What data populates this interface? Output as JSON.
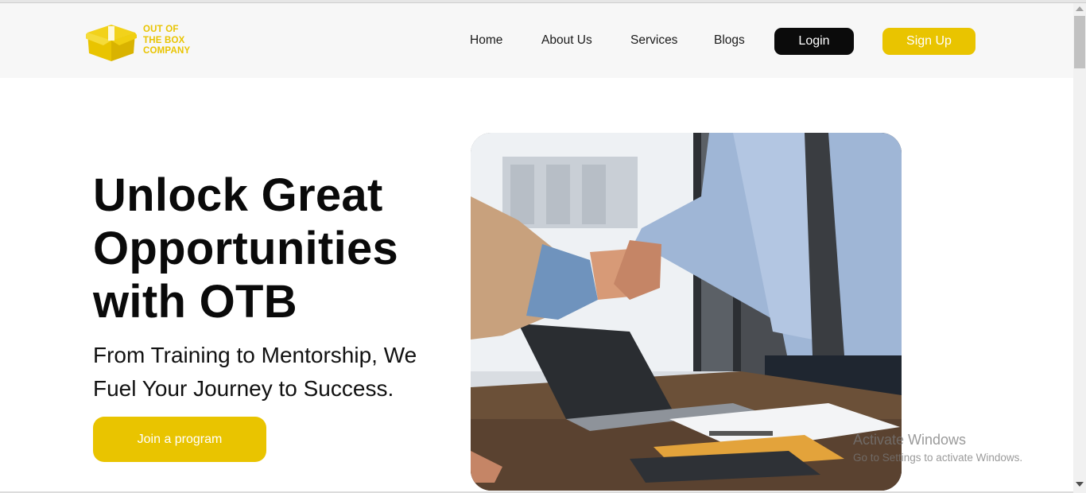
{
  "brand": {
    "logo_icon": "box-icon",
    "logo_lines": [
      "OUT OF",
      "THE BOX",
      "COMPANY"
    ],
    "accent_color": "#e9c400"
  },
  "nav": {
    "links": [
      "Home",
      "About Us",
      "Services",
      "Blogs"
    ],
    "login_label": "Login",
    "signup_label": "Sign Up"
  },
  "hero": {
    "title_lines": [
      "Unlock Great",
      "Opportunities",
      "with OTB"
    ],
    "subtitle_lines": [
      "From Training to Mentorship, We",
      "Fuel Your Journey to Success."
    ],
    "cta_label": "Join a program",
    "image_icon": "handshake-photo"
  },
  "watermark": {
    "title": "Activate Windows",
    "subtitle": "Go to Settings to activate Windows."
  }
}
